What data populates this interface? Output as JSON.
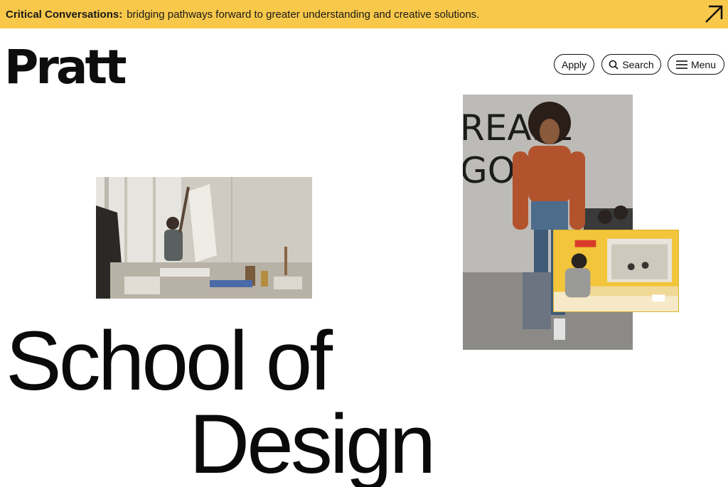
{
  "banner": {
    "bold_label": "Critical Conversations:",
    "text": "bridging pathways forward to greater understanding and creative solutions.",
    "background_color": "#f8c84a",
    "arrow_icon": "arrow-up-right-icon"
  },
  "header": {
    "logo_text": "Pratt",
    "apply_label": "Apply",
    "search_label": "Search",
    "search_icon": "search-icon",
    "menu_label": "Menu",
    "menu_icon": "hamburger-icon"
  },
  "hero": {
    "heading_line_1": "School of",
    "heading_line_2": "Design"
  }
}
